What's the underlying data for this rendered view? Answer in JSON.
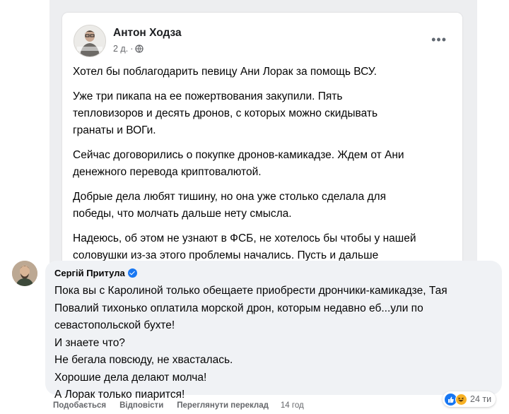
{
  "post": {
    "author": "Антон Ходза",
    "time": "2 д.",
    "privacy_icon": "globe-icon",
    "more_label": "•••",
    "paragraphs": [
      [
        "Хотел бы поблагодарить певицу Ани Лорак за помощь ВСУ."
      ],
      [
        "Уже три пикапа на ее пожертвования закупили. Пять",
        "тепловизоров и десять дронов, с которых можно скидывать",
        "гранаты и ВОГи."
      ],
      [
        "Сейчас договорились о покупке дронов-камикадзе. Ждем от Ани",
        "денежного перевода криптовалютой."
      ],
      [
        "Добрые дела любят тишину, но она уже столько сделала для",
        "победы, что молчать дальше нету смысла."
      ],
      [
        "Надеюсь, об этом не узнают в ФСБ, не хотелось бы чтобы у нашей",
        "соловушки из-за этого проблемы начались. Пусть и дальше"
      ]
    ]
  },
  "comment": {
    "author": "Сергій Притула",
    "verified": true,
    "lines": [
      "Пока вы с Каролиной только обещаете приобрести дрончики-камикадзе, Тая",
      "Повалий тихонько оплатила морской дрон, которым недавно еб...ули по",
      "севастопольской бухте!",
      "И знаете что?",
      "Не бегала повсюду, не хвасталась.",
      "Хорошие дела делают молча!",
      "А Лорак только пиарится!"
    ],
    "reactions": {
      "icons": [
        "like-icon",
        "haha-icon"
      ],
      "count": "24 ти"
    },
    "actions": {
      "like": "Подобається",
      "reply": "Відповісти",
      "translate": "Переглянути переклад",
      "time": "14 год"
    }
  },
  "colors": {
    "facebook_blue": "#1877f2",
    "bubble_gray": "#f0f2f5",
    "meta_gray": "#65676b"
  }
}
